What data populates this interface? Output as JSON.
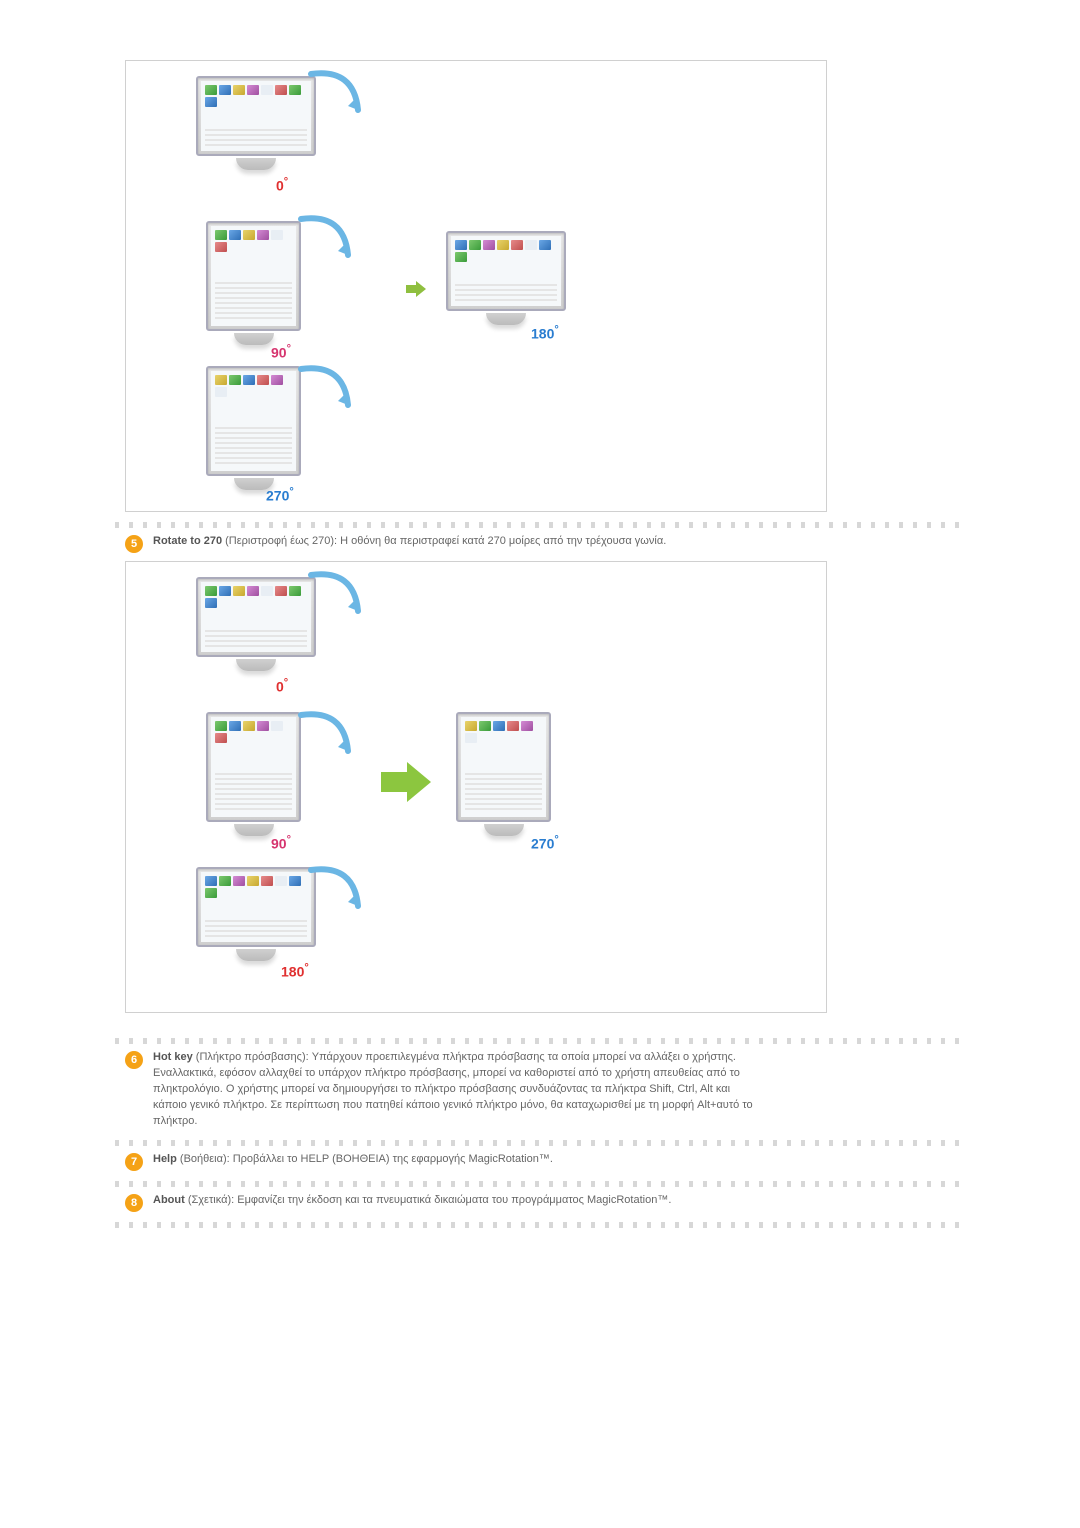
{
  "labels": {
    "deg0": "0",
    "deg90": "90",
    "deg180": "180",
    "deg270": "270",
    "degree_symbol": "°"
  },
  "items": {
    "5": {
      "title": "Rotate to 270",
      "subtitle": " (Περιστροφή έως 270): Η οθόνη θα περιστραφεί κατά 270 μοίρες από την τρέχουσα γωνία."
    },
    "6": {
      "title": "Hot key",
      "subtitle": " (Πλήκτρο πρόσβασης): Υπάρχουν προεπιλεγμένα πλήκτρα πρόσβασης τα οποία μπορεί να αλλάξει ο χρήστης.",
      "extra": "Εναλλακτικά, εφόσον αλλαχθεί το υπάρχον πλήκτρο πρόσβασης, μπορεί να καθοριστεί από το χρήστη απευθείας από το πληκτρολόγιο. Ο χρήστης μπορεί να δημιουργήσει το πλήκτρο πρόσβασης συνδυάζοντας τα πλήκτρα Shift, Ctrl, Alt και κάποιο γενικό πλήκτρο. Σε περίπτωση που πατηθεί κάποιο γενικό πλήκτρο μόνο, θα καταχωρισθεί με τη μορφή Alt+αυτό το πλήκτρο."
    },
    "7": {
      "title": "Help",
      "subtitle": " (Βοήθεια): Προβάλλει το HELP (ΒΟΗΘΕΙΑ) της εφαρμογής MagicRotation™."
    },
    "8": {
      "title": "About",
      "subtitle": " (Σχετικά): Εμφανίζει την έκδοση και τα πνευματικά δικαιώματα του προγράμματος MagicRotation™."
    }
  }
}
